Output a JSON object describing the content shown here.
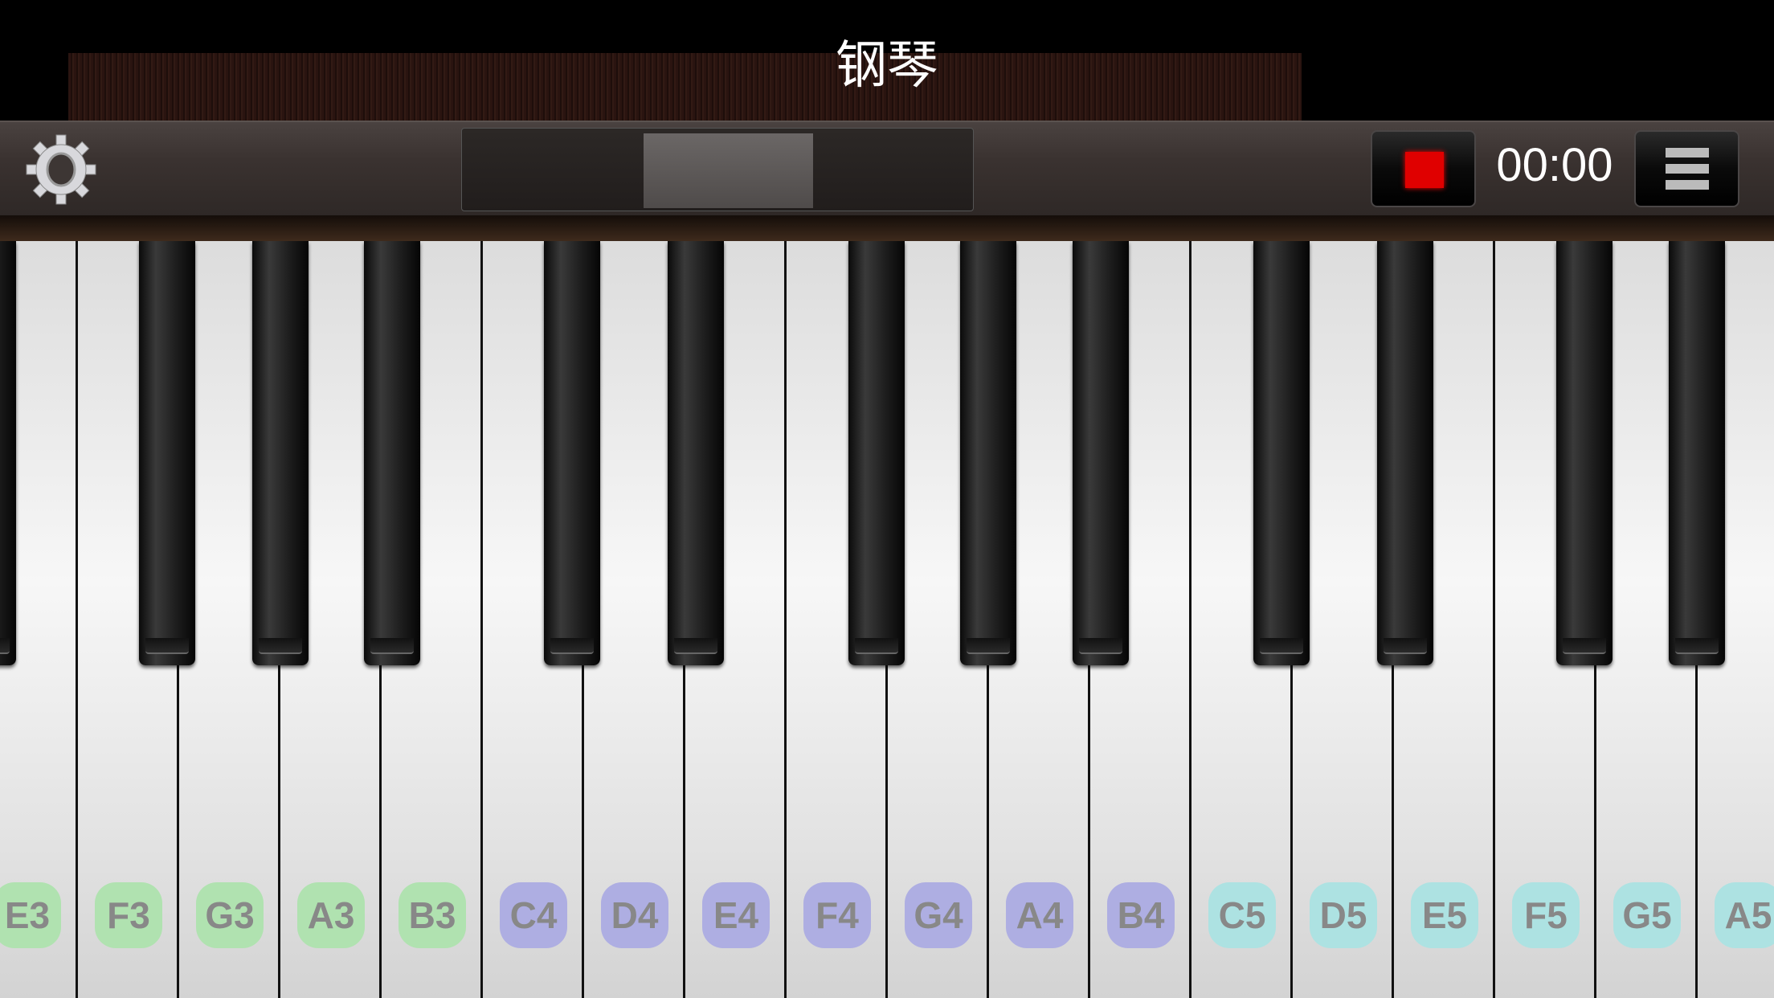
{
  "app": {
    "title": "钢琴"
  },
  "toolbar": {
    "settings_icon": "gear-icon",
    "record_icon": "stop-square-icon",
    "record_color": "#e00000",
    "time": "00:00",
    "menu_icon": "hamburger-menu-icon"
  },
  "label_colors": {
    "3": "#b0e2b0",
    "4": "#aeaee2",
    "5": "#ade2e2"
  },
  "white_keys": [
    {
      "note": "E3",
      "label": "E3"
    },
    {
      "note": "F3",
      "label": "F3"
    },
    {
      "note": "G3",
      "label": "G3"
    },
    {
      "note": "A3",
      "label": "A3"
    },
    {
      "note": "B3",
      "label": "B3"
    },
    {
      "note": "C4",
      "label": "C4"
    },
    {
      "note": "D4",
      "label": "D4"
    },
    {
      "note": "E4",
      "label": "E4"
    },
    {
      "note": "F4",
      "label": "F4"
    },
    {
      "note": "G4",
      "label": "G4"
    },
    {
      "note": "A4",
      "label": "A4"
    },
    {
      "note": "B4",
      "label": "B4"
    },
    {
      "note": "C5",
      "label": "C5"
    },
    {
      "note": "D5",
      "label": "D5"
    },
    {
      "note": "E5",
      "label": "E5"
    },
    {
      "note": "F5",
      "label": "F5"
    },
    {
      "note": "G5",
      "label": "G5"
    },
    {
      "note": "A5",
      "label": "A5"
    }
  ],
  "black_keys": [
    "D#3",
    "F#3",
    "G#3",
    "A#3",
    "C#4",
    "D#4",
    "F#4",
    "G#4",
    "A#4",
    "C#5",
    "D#5",
    "F#5",
    "G#5"
  ]
}
